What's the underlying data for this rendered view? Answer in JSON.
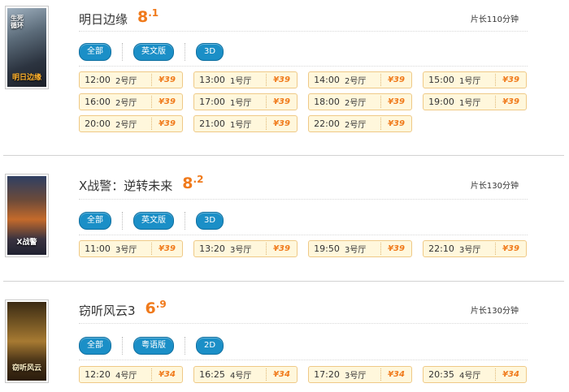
{
  "movies": [
    {
      "title": "明日边缘",
      "score_int": "8",
      "score_dec": ".1",
      "duration": "片长110分钟",
      "poster_text": "明日边缘",
      "poster_top_text": "生死循环",
      "tags": [
        "全部",
        "英文版",
        "3D"
      ],
      "showtimes": [
        {
          "time": "12:00",
          "hall": "2号厅",
          "price": "¥39"
        },
        {
          "time": "13:00",
          "hall": "1号厅",
          "price": "¥39"
        },
        {
          "time": "14:00",
          "hall": "2号厅",
          "price": "¥39"
        },
        {
          "time": "15:00",
          "hall": "1号厅",
          "price": "¥39"
        },
        {
          "time": "16:00",
          "hall": "2号厅",
          "price": "¥39"
        },
        {
          "time": "17:00",
          "hall": "1号厅",
          "price": "¥39"
        },
        {
          "time": "18:00",
          "hall": "2号厅",
          "price": "¥39"
        },
        {
          "time": "19:00",
          "hall": "1号厅",
          "price": "¥39"
        },
        {
          "time": "20:00",
          "hall": "2号厅",
          "price": "¥39"
        },
        {
          "time": "21:00",
          "hall": "1号厅",
          "price": "¥39"
        },
        {
          "time": "22:00",
          "hall": "2号厅",
          "price": "¥39"
        }
      ]
    },
    {
      "title": "X战警：逆转未来",
      "score_int": "8",
      "score_dec": ".2",
      "duration": "片长130分钟",
      "poster_text": "X战警",
      "poster_top_text": "",
      "tags": [
        "全部",
        "英文版",
        "3D"
      ],
      "showtimes": [
        {
          "time": "11:00",
          "hall": "3号厅",
          "price": "¥39"
        },
        {
          "time": "13:20",
          "hall": "3号厅",
          "price": "¥39"
        },
        {
          "time": "19:50",
          "hall": "3号厅",
          "price": "¥39"
        },
        {
          "time": "22:10",
          "hall": "3号厅",
          "price": "¥39"
        }
      ]
    },
    {
      "title": "窃听风云3",
      "score_int": "6",
      "score_dec": ".9",
      "duration": "片长130分钟",
      "poster_text": "窃听风云",
      "poster_top_text": "",
      "tags": [
        "全部",
        "粤语版",
        "2D"
      ],
      "showtimes": [
        {
          "time": "12:20",
          "hall": "4号厅",
          "price": "¥34"
        },
        {
          "time": "16:25",
          "hall": "4号厅",
          "price": "¥34"
        },
        {
          "time": "17:20",
          "hall": "3号厅",
          "price": "¥34"
        },
        {
          "time": "20:35",
          "hall": "4号厅",
          "price": "¥34"
        }
      ]
    }
  ],
  "colors": {
    "accent": "#f07a1b",
    "tag_blue": "#1b8fc7",
    "show_bg": "#fff7dc",
    "show_border": "#efc986"
  }
}
